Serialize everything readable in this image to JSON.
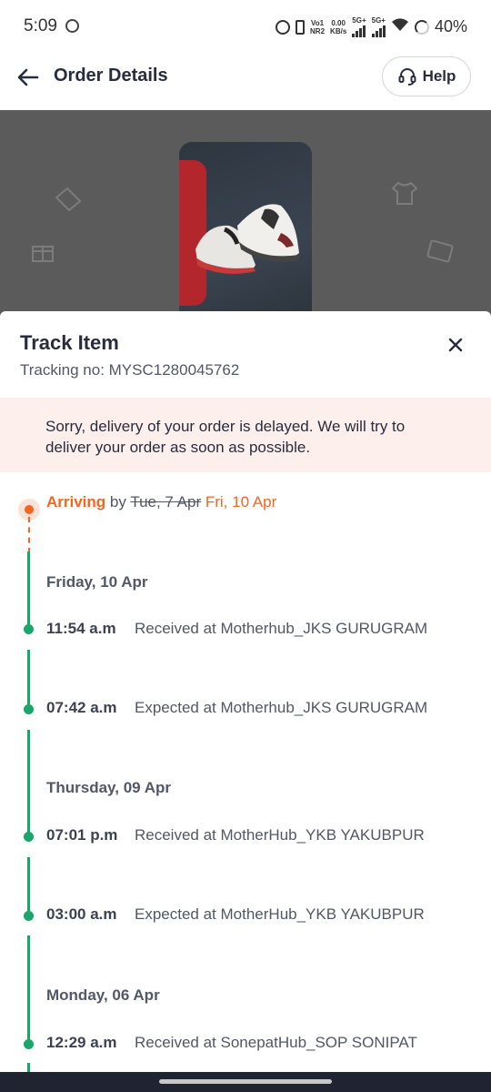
{
  "status_bar": {
    "time": "5:09",
    "net_top": "Vo1",
    "net_bottom": "NR2",
    "speed_top": "0.00",
    "speed_bottom": "KB/s",
    "sim1": "5G+",
    "sim2": "5G+",
    "battery": "40%"
  },
  "app_bar": {
    "title": "Order Details",
    "help_label": "Help"
  },
  "sheet": {
    "title": "Track Item",
    "tracking_label": "Tracking no: MYSC1280045762",
    "banner_text": "Sorry, delivery of your order is delayed. We will try to deliver your order as soon as possible.",
    "arriving_label": "Arriving",
    "arriving_by": "by",
    "old_date": "Tue, 7 Apr",
    "new_date": "Fri, 10 Apr"
  },
  "timeline": [
    {
      "date": "Friday, 10 Apr",
      "events": [
        {
          "time": "11:54 a.m",
          "text": "Received at Motherhub_JKS GURUGRAM"
        },
        {
          "time": "07:42 a.m",
          "text": "Expected at Motherhub_JKS GURUGRAM"
        }
      ]
    },
    {
      "date": "Thursday, 09 Apr",
      "events": [
        {
          "time": "07:01 p.m",
          "text": "Received at MotherHub_YKB YAKUBPUR"
        },
        {
          "time": "03:00 a.m",
          "text": "Expected at MotherHub_YKB YAKUBPUR"
        }
      ]
    },
    {
      "date": "Monday, 06 Apr",
      "events": [
        {
          "time": "12:29 a.m",
          "text": "Received at SonepatHub_SOP SONIPAT"
        }
      ]
    }
  ],
  "colors": {
    "accent_orange": "#f16722",
    "timeline_green": "#1ba56e",
    "banner_bg": "#fdf0ec"
  }
}
